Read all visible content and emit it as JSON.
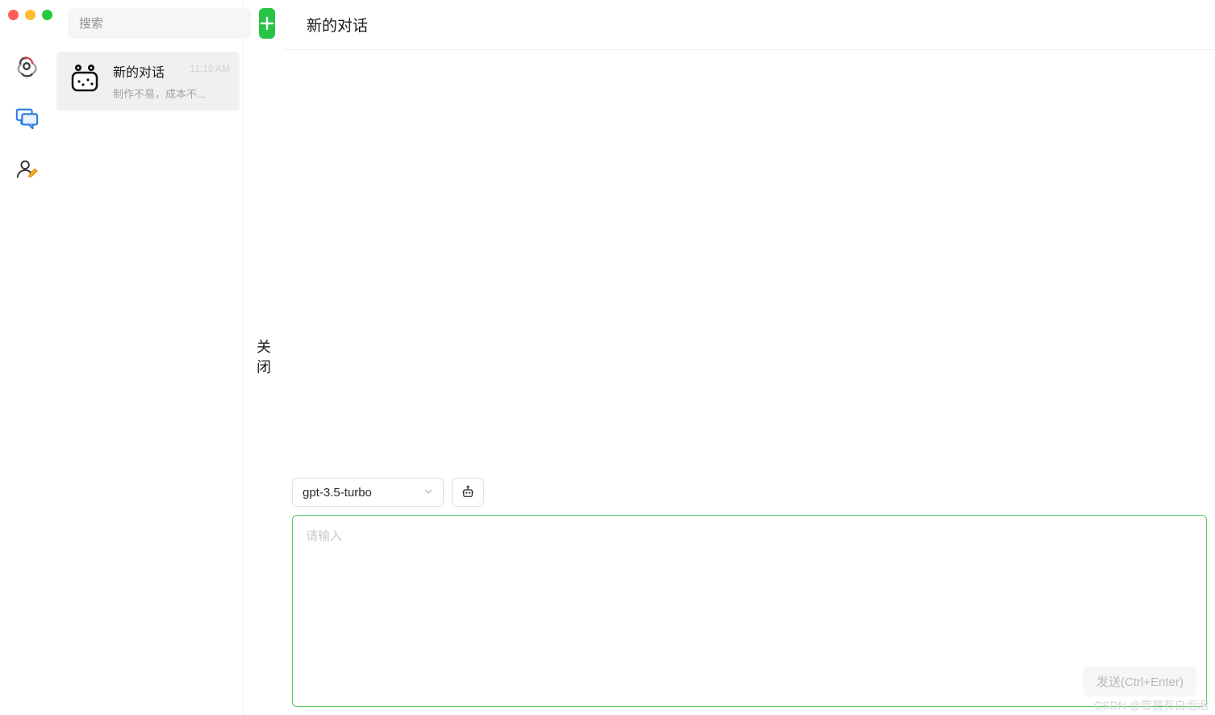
{
  "window": {
    "traffic_colors": {
      "close": "#ff5f57",
      "min": "#febc2e",
      "max": "#28c840"
    }
  },
  "rail": {
    "items": [
      {
        "name": "logo-icon"
      },
      {
        "name": "chat-icon"
      },
      {
        "name": "user-edit-icon"
      }
    ]
  },
  "sidebar": {
    "search_placeholder": "搜索",
    "new_chat_tooltip": "新建对话",
    "collapse_label": "关闭",
    "conversations": [
      {
        "title": "新的对话",
        "subtitle": "制作不易，成本不...",
        "time": "11:19 AM"
      }
    ]
  },
  "main": {
    "title": "新的对话"
  },
  "composer": {
    "model": "gpt-3.5-turbo",
    "input_placeholder": "请输入",
    "send_label": "发送(Ctrl+Enter)"
  },
  "watermark": "CSDN @雪碧有白泡泡"
}
